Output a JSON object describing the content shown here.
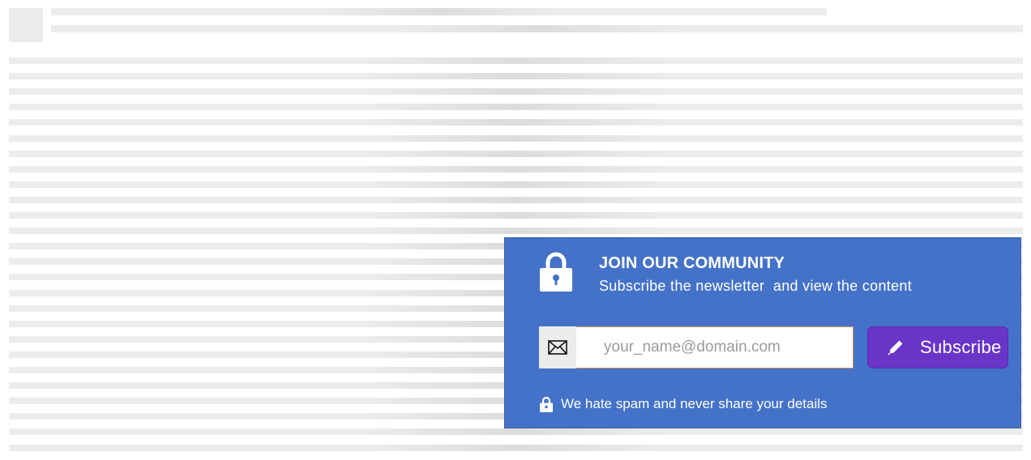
{
  "newsletter": {
    "icon": "lock-icon",
    "heading": "JOIN OUR COMMUNITY",
    "subheading": "Subscribe the newsletter  and view the content",
    "email": {
      "icon": "envelope-icon",
      "placeholder": "your_name@domain.com",
      "value": ""
    },
    "subscribe_button": {
      "icon": "pencil-icon",
      "label": "Subscribe"
    },
    "privacy_note": {
      "icon": "lock-icon",
      "text": "We hate spam and never share your details"
    },
    "colors": {
      "panel": "#4472c8",
      "button": "#6a34c8",
      "input_border": "#d98a5a",
      "placeholder_bars": "#ececec"
    }
  }
}
